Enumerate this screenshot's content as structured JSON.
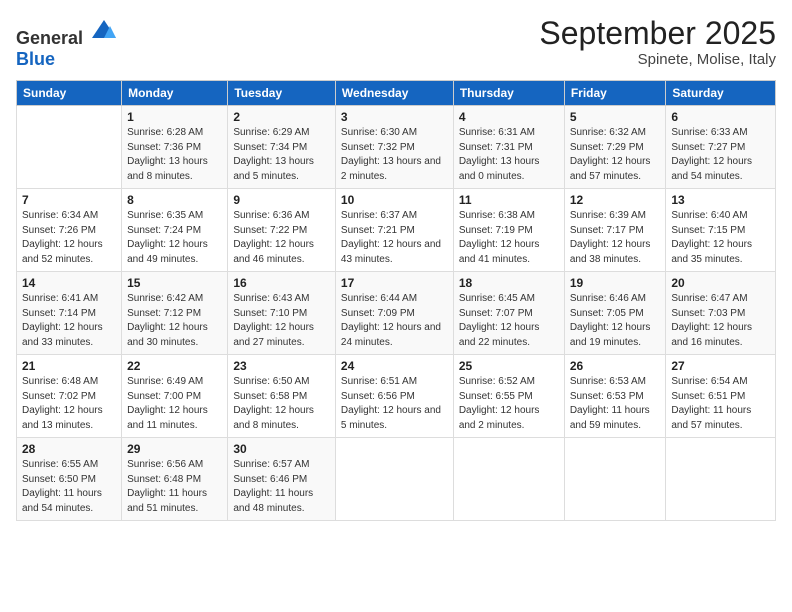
{
  "logo": {
    "general": "General",
    "blue": "Blue"
  },
  "header": {
    "month": "September 2025",
    "location": "Spinete, Molise, Italy"
  },
  "weekdays": [
    "Sunday",
    "Monday",
    "Tuesday",
    "Wednesday",
    "Thursday",
    "Friday",
    "Saturday"
  ],
  "weeks": [
    [
      {
        "day": "",
        "sunrise": "",
        "sunset": "",
        "daylight": ""
      },
      {
        "day": "1",
        "sunrise": "Sunrise: 6:28 AM",
        "sunset": "Sunset: 7:36 PM",
        "daylight": "Daylight: 13 hours and 8 minutes."
      },
      {
        "day": "2",
        "sunrise": "Sunrise: 6:29 AM",
        "sunset": "Sunset: 7:34 PM",
        "daylight": "Daylight: 13 hours and 5 minutes."
      },
      {
        "day": "3",
        "sunrise": "Sunrise: 6:30 AM",
        "sunset": "Sunset: 7:32 PM",
        "daylight": "Daylight: 13 hours and 2 minutes."
      },
      {
        "day": "4",
        "sunrise": "Sunrise: 6:31 AM",
        "sunset": "Sunset: 7:31 PM",
        "daylight": "Daylight: 13 hours and 0 minutes."
      },
      {
        "day": "5",
        "sunrise": "Sunrise: 6:32 AM",
        "sunset": "Sunset: 7:29 PM",
        "daylight": "Daylight: 12 hours and 57 minutes."
      },
      {
        "day": "6",
        "sunrise": "Sunrise: 6:33 AM",
        "sunset": "Sunset: 7:27 PM",
        "daylight": "Daylight: 12 hours and 54 minutes."
      }
    ],
    [
      {
        "day": "7",
        "sunrise": "Sunrise: 6:34 AM",
        "sunset": "Sunset: 7:26 PM",
        "daylight": "Daylight: 12 hours and 52 minutes."
      },
      {
        "day": "8",
        "sunrise": "Sunrise: 6:35 AM",
        "sunset": "Sunset: 7:24 PM",
        "daylight": "Daylight: 12 hours and 49 minutes."
      },
      {
        "day": "9",
        "sunrise": "Sunrise: 6:36 AM",
        "sunset": "Sunset: 7:22 PM",
        "daylight": "Daylight: 12 hours and 46 minutes."
      },
      {
        "day": "10",
        "sunrise": "Sunrise: 6:37 AM",
        "sunset": "Sunset: 7:21 PM",
        "daylight": "Daylight: 12 hours and 43 minutes."
      },
      {
        "day": "11",
        "sunrise": "Sunrise: 6:38 AM",
        "sunset": "Sunset: 7:19 PM",
        "daylight": "Daylight: 12 hours and 41 minutes."
      },
      {
        "day": "12",
        "sunrise": "Sunrise: 6:39 AM",
        "sunset": "Sunset: 7:17 PM",
        "daylight": "Daylight: 12 hours and 38 minutes."
      },
      {
        "day": "13",
        "sunrise": "Sunrise: 6:40 AM",
        "sunset": "Sunset: 7:15 PM",
        "daylight": "Daylight: 12 hours and 35 minutes."
      }
    ],
    [
      {
        "day": "14",
        "sunrise": "Sunrise: 6:41 AM",
        "sunset": "Sunset: 7:14 PM",
        "daylight": "Daylight: 12 hours and 33 minutes."
      },
      {
        "day": "15",
        "sunrise": "Sunrise: 6:42 AM",
        "sunset": "Sunset: 7:12 PM",
        "daylight": "Daylight: 12 hours and 30 minutes."
      },
      {
        "day": "16",
        "sunrise": "Sunrise: 6:43 AM",
        "sunset": "Sunset: 7:10 PM",
        "daylight": "Daylight: 12 hours and 27 minutes."
      },
      {
        "day": "17",
        "sunrise": "Sunrise: 6:44 AM",
        "sunset": "Sunset: 7:09 PM",
        "daylight": "Daylight: 12 hours and 24 minutes."
      },
      {
        "day": "18",
        "sunrise": "Sunrise: 6:45 AM",
        "sunset": "Sunset: 7:07 PM",
        "daylight": "Daylight: 12 hours and 22 minutes."
      },
      {
        "day": "19",
        "sunrise": "Sunrise: 6:46 AM",
        "sunset": "Sunset: 7:05 PM",
        "daylight": "Daylight: 12 hours and 19 minutes."
      },
      {
        "day": "20",
        "sunrise": "Sunrise: 6:47 AM",
        "sunset": "Sunset: 7:03 PM",
        "daylight": "Daylight: 12 hours and 16 minutes."
      }
    ],
    [
      {
        "day": "21",
        "sunrise": "Sunrise: 6:48 AM",
        "sunset": "Sunset: 7:02 PM",
        "daylight": "Daylight: 12 hours and 13 minutes."
      },
      {
        "day": "22",
        "sunrise": "Sunrise: 6:49 AM",
        "sunset": "Sunset: 7:00 PM",
        "daylight": "Daylight: 12 hours and 11 minutes."
      },
      {
        "day": "23",
        "sunrise": "Sunrise: 6:50 AM",
        "sunset": "Sunset: 6:58 PM",
        "daylight": "Daylight: 12 hours and 8 minutes."
      },
      {
        "day": "24",
        "sunrise": "Sunrise: 6:51 AM",
        "sunset": "Sunset: 6:56 PM",
        "daylight": "Daylight: 12 hours and 5 minutes."
      },
      {
        "day": "25",
        "sunrise": "Sunrise: 6:52 AM",
        "sunset": "Sunset: 6:55 PM",
        "daylight": "Daylight: 12 hours and 2 minutes."
      },
      {
        "day": "26",
        "sunrise": "Sunrise: 6:53 AM",
        "sunset": "Sunset: 6:53 PM",
        "daylight": "Daylight: 11 hours and 59 minutes."
      },
      {
        "day": "27",
        "sunrise": "Sunrise: 6:54 AM",
        "sunset": "Sunset: 6:51 PM",
        "daylight": "Daylight: 11 hours and 57 minutes."
      }
    ],
    [
      {
        "day": "28",
        "sunrise": "Sunrise: 6:55 AM",
        "sunset": "Sunset: 6:50 PM",
        "daylight": "Daylight: 11 hours and 54 minutes."
      },
      {
        "day": "29",
        "sunrise": "Sunrise: 6:56 AM",
        "sunset": "Sunset: 6:48 PM",
        "daylight": "Daylight: 11 hours and 51 minutes."
      },
      {
        "day": "30",
        "sunrise": "Sunrise: 6:57 AM",
        "sunset": "Sunset: 6:46 PM",
        "daylight": "Daylight: 11 hours and 48 minutes."
      },
      {
        "day": "",
        "sunrise": "",
        "sunset": "",
        "daylight": ""
      },
      {
        "day": "",
        "sunrise": "",
        "sunset": "",
        "daylight": ""
      },
      {
        "day": "",
        "sunrise": "",
        "sunset": "",
        "daylight": ""
      },
      {
        "day": "",
        "sunrise": "",
        "sunset": "",
        "daylight": ""
      }
    ]
  ]
}
